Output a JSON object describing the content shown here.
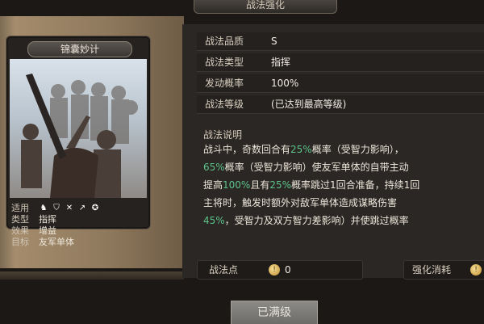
{
  "header": {
    "title": "战法强化"
  },
  "card": {
    "name": "锦囊妙计",
    "troop_label": "适用",
    "troop_icons": [
      "cavalry-icon",
      "shield-icon",
      "bow-icon",
      "spear-icon",
      "siege-icon"
    ],
    "type_label": "类型",
    "type_value": "指挥",
    "effect_label": "效果",
    "effect_value": "增益",
    "target_label": "目标",
    "target_value": "友军单体"
  },
  "attributes": {
    "quality_label": "战法品质",
    "quality_value": "S",
    "type_label": "战法类型",
    "type_value": "指挥",
    "rate_label": "发动概率",
    "rate_value": "100%",
    "level_label": "战法等级",
    "level_value": "(已达到最高等级)"
  },
  "description": {
    "title": "战法说明",
    "line1_a": "战斗中，奇数回合有",
    "line1_hl": "25%",
    "line1_b": "概率（受智力影响），",
    "line2_hl": "65%",
    "line2_b": "概率（受智力影响）使友军单体的自带主动",
    "line3_a": "提高",
    "line3_hl1": "100%",
    "line3_b": "且有",
    "line3_hl2": "25%",
    "line3_c": "概率跳过1回合准备，持续1回",
    "line4_a": "主将时，触发时额外对敌军单体造成谋略伤害",
    "line5_hl": "45%",
    "line5_b": "，受智力及双方智力差影响）并使跳过概率"
  },
  "footer": {
    "points_label": "战法点",
    "points_value": "0",
    "cost_label": "强化消耗",
    "maxed_button": "已满级"
  },
  "colors": {
    "highlight": "#5cc28a",
    "coin": "#e0b24a"
  }
}
